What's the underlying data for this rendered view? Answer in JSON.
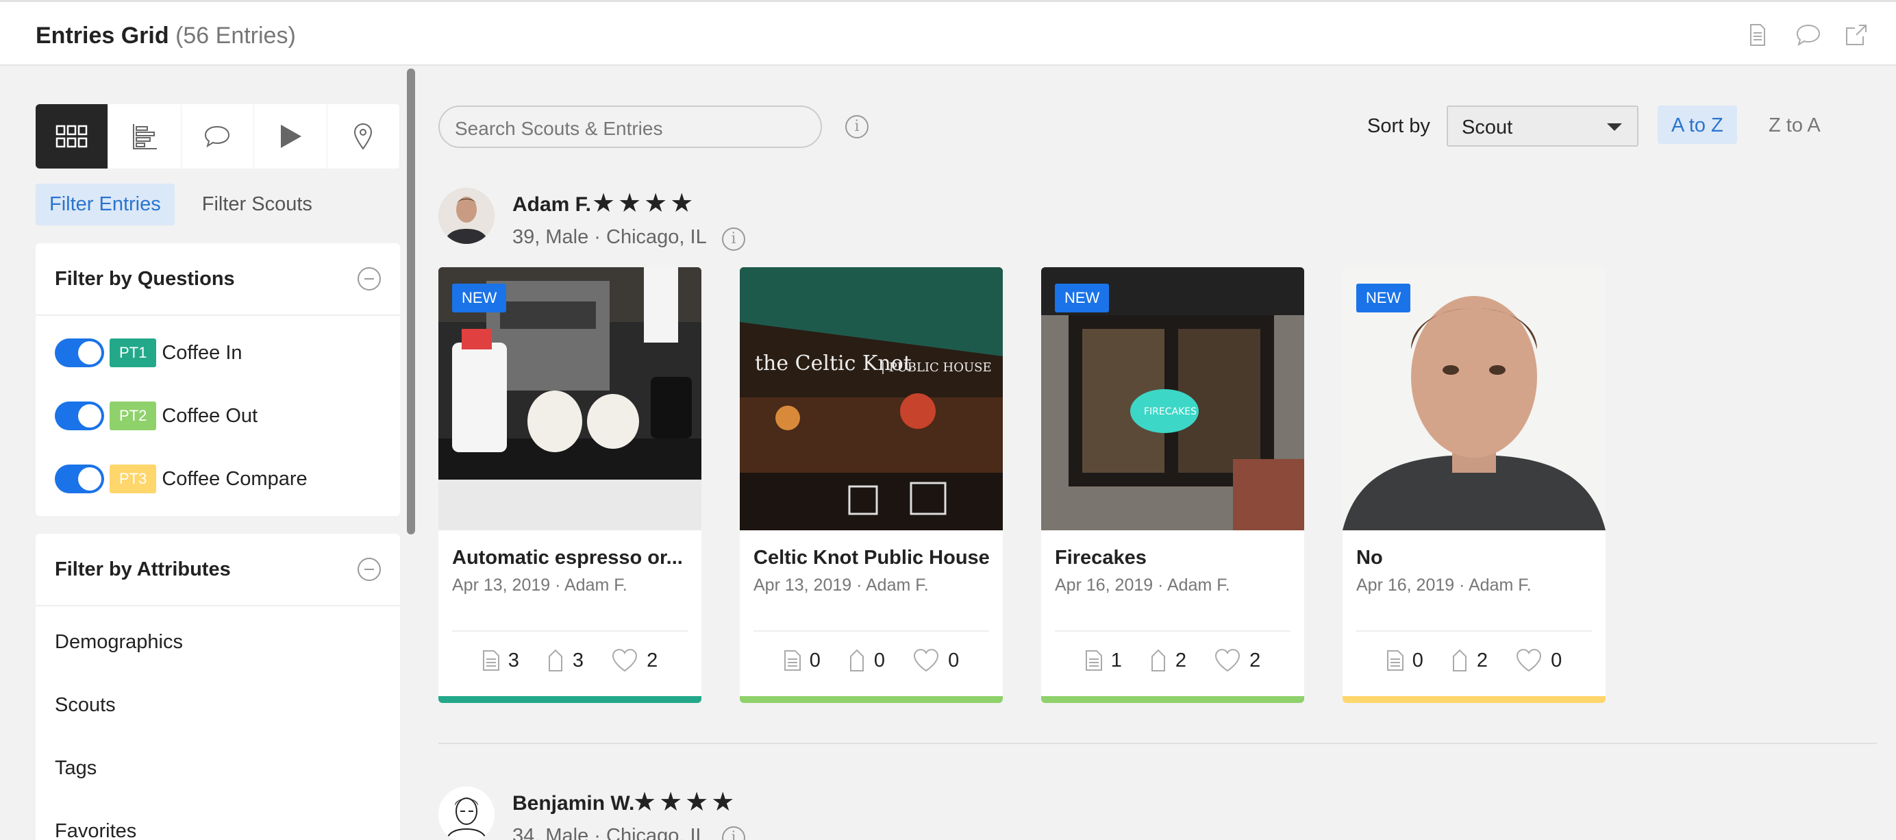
{
  "header": {
    "title": "Entries Grid",
    "count": "(56 Entries)"
  },
  "top_icons": [
    "document-icon",
    "comment-icon",
    "share-icon"
  ],
  "view_tabs": [
    "grid-icon",
    "list-icon",
    "chat-icon",
    "play-icon",
    "location-pin-icon"
  ],
  "filter_toggle": {
    "entries": "Filter Entries",
    "scouts": "Filter Scouts"
  },
  "filter_questions": {
    "title": "Filter by Questions",
    "items": [
      {
        "tag": "PT1",
        "label": "Coffee In",
        "color": "#23a88a"
      },
      {
        "tag": "PT2",
        "label": "Coffee Out",
        "color": "#8fd16b"
      },
      {
        "tag": "PT3",
        "label": "Coffee Compare",
        "color": "#ffd66b"
      }
    ]
  },
  "filter_attributes": {
    "title": "Filter by Attributes",
    "items": [
      "Demographics",
      "Scouts",
      "Tags",
      "Favorites"
    ]
  },
  "search": {
    "placeholder": "Search Scouts & Entries"
  },
  "sort": {
    "label": "Sort by",
    "selected": "Scout",
    "az": "A to Z",
    "za": "Z to A"
  },
  "scouts": [
    {
      "name": "Adam F.",
      "stars": "★★★★",
      "meta": "39, Male · Chicago, IL",
      "entries": [
        {
          "title": "Automatic espresso or...",
          "meta": "Apr 13, 2019 · Adam F.",
          "new": "NEW",
          "notes": "3",
          "tags": "3",
          "likes": "2",
          "bar": "#23a88a"
        },
        {
          "title": "Celtic Knot Public House",
          "meta": "Apr 13, 2019 · Adam F.",
          "new": "",
          "notes": "0",
          "tags": "0",
          "likes": "0",
          "bar": "#8fd16b"
        },
        {
          "title": "Firecakes",
          "meta": "Apr 16, 2019 · Adam F.",
          "new": "NEW",
          "notes": "1",
          "tags": "2",
          "likes": "2",
          "bar": "#8fd16b"
        },
        {
          "title": "No",
          "meta": "Apr 16, 2019 · Adam F.",
          "new": "NEW",
          "notes": "0",
          "tags": "2",
          "likes": "0",
          "bar": "#ffd66b"
        }
      ]
    },
    {
      "name": "Benjamin W.",
      "stars": "★★★★",
      "meta": "34, Male · Chicago, IL"
    }
  ]
}
